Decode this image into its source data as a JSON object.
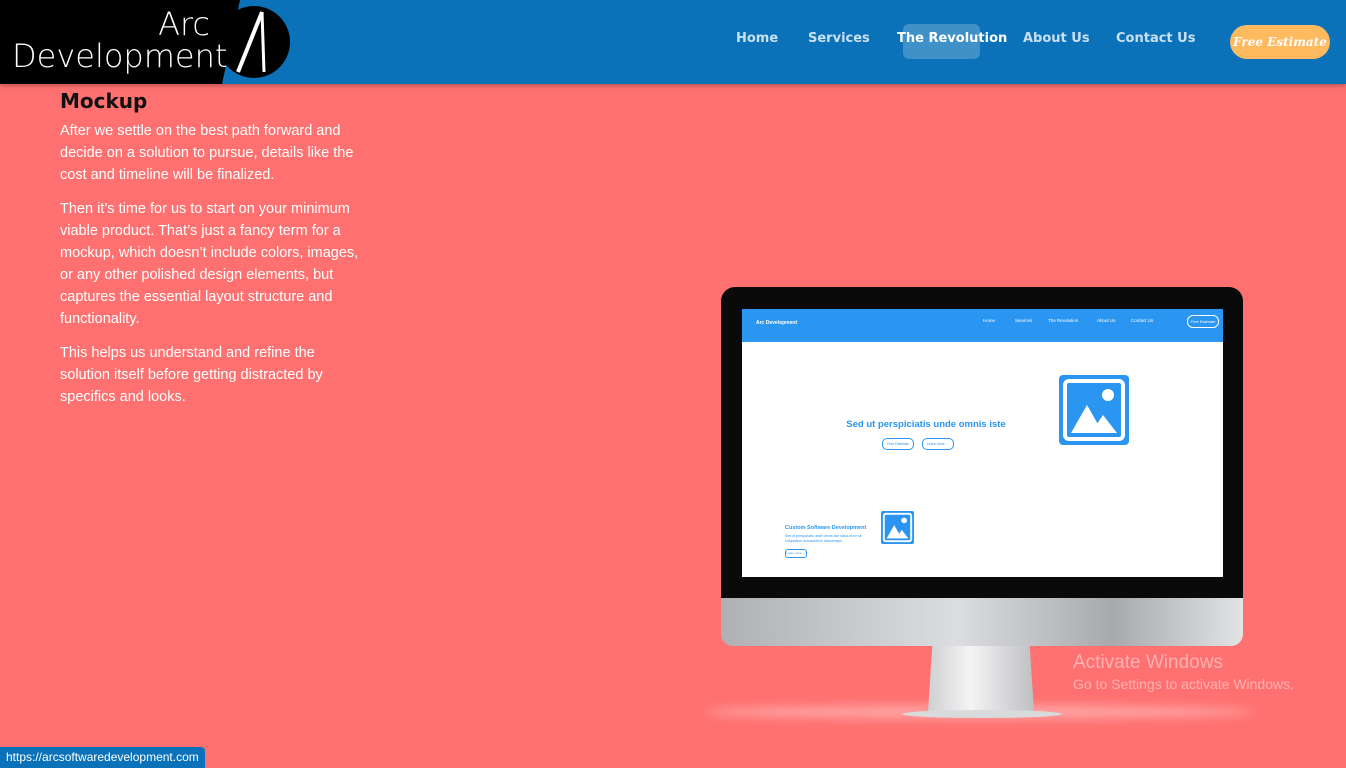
{
  "header": {
    "logo_line1": "Arc",
    "logo_line2": "Development",
    "tabs": [
      {
        "label": "Home"
      },
      {
        "label": "Services"
      },
      {
        "label": "The Revolution"
      },
      {
        "label": "About Us"
      },
      {
        "label": "Contact Us"
      }
    ],
    "estimate_label": "Free Estimate"
  },
  "section": {
    "title": "Mockup",
    "paragraphs": [
      "After we settle on the best path forward and decide on a solution to pursue, details like the cost and timeline will be finalized.",
      "Then it’s time for us to start on your minimum viable product. That’s just a fancy term for a mockup, which doesn’t include colors, images, or any other polished design elements, but captures the essential layout structure and functionality.",
      "This helps us understand and refine the solution itself before getting distracted by specifics and looks."
    ]
  },
  "mockup_screen": {
    "brand": "Arc Development",
    "links": [
      "Home",
      "Services",
      "The Revolution",
      "About Us",
      "Contact Us"
    ],
    "estimate": "Free Estimate",
    "hero_text": "Sed ut perspiciatis unde omnis iste",
    "hero_buttons": [
      "Free Estimate",
      "Learn more →"
    ],
    "service_title": "Custom Software Development",
    "service_text": "Sed ut perspiciatis unde omnis iste natus error sit voluptatem accusantium doloremque",
    "service_button": "Learn more →"
  },
  "watermark": {
    "line1": "Activate Windows",
    "line2": "Go to Settings to activate Windows."
  },
  "status_url": "https://arcsoftwaredevelopment.com",
  "colors": {
    "appbar": "#0b72b9",
    "background": "#ff7171",
    "estimate": "#ffba60",
    "mockup_blue": "#2b96f2"
  }
}
